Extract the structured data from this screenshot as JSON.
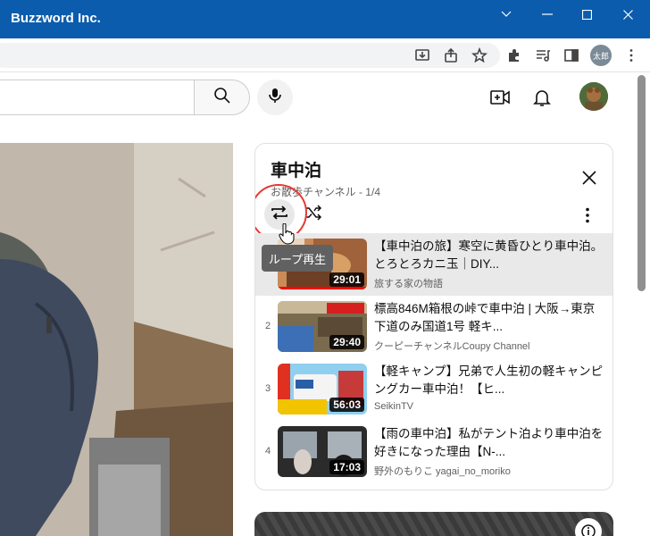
{
  "window": {
    "title": "Buzzword Inc."
  },
  "browser": {
    "profile_label": "太郎"
  },
  "playlist": {
    "title": "車中泊",
    "subtitle": "お散歩チャンネル - 1/4",
    "loop_tooltip": "ループ再生",
    "items": [
      {
        "index": "",
        "title": "【車中泊の旅】寒空に黄昏ひとり車中泊。とろとろカニ玉｜DIY...",
        "channel": "旅する家の物語",
        "duration": "29:01",
        "active": true,
        "watched": 1.0
      },
      {
        "index": "2",
        "title": "標高846M箱根の峠で車中泊 | 大阪→東京下道のみ国道1号 軽キ...",
        "channel": "クーピーチャンネルCoupy Channel",
        "duration": "29:40",
        "active": false,
        "watched": 0.0
      },
      {
        "index": "3",
        "title": "【軽キャンプ】兄弟で人生初の軽キャンピングカー車中泊！【ヒ...",
        "channel": "SeikinTV",
        "duration": "56:03",
        "active": false,
        "watched": 0.0
      },
      {
        "index": "4",
        "title": "【雨の車中泊】私がテント泊より車中泊を好きになった理由【N-...",
        "channel": "野外のもりこ yagai_no_moriko",
        "duration": "17:03",
        "active": false,
        "watched": 0.0
      }
    ]
  },
  "colors": {
    "titlebar": "#0b5cad",
    "accent": "#ff0000",
    "highlight": "#e53935"
  }
}
